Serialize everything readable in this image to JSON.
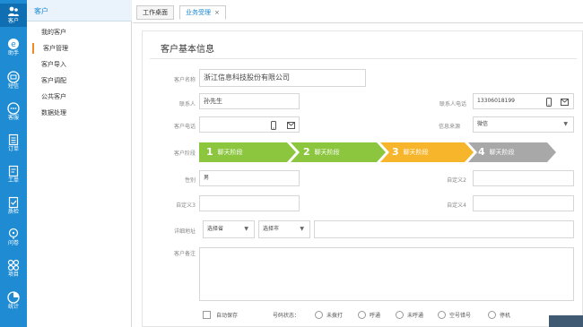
{
  "rail": [
    {
      "label": "客户",
      "icon": "customer-icon"
    },
    {
      "label": "助手",
      "icon": "assistant-icon"
    },
    {
      "label": "短信",
      "icon": "sms-icon"
    },
    {
      "label": "客服",
      "icon": "chat-icon"
    },
    {
      "label": "订单",
      "icon": "order-icon"
    },
    {
      "label": "工单",
      "icon": "ticket-icon"
    },
    {
      "label": "质检",
      "icon": "quality-check-icon"
    },
    {
      "label": "问卷",
      "icon": "survey-icon"
    },
    {
      "label": "项目",
      "icon": "project-icon"
    },
    {
      "label": "统计",
      "icon": "statistics-icon"
    }
  ],
  "subnav": {
    "title": "客户",
    "items": [
      "我的客户",
      "客户管理",
      "客户导入",
      "客户调配",
      "公共客户",
      "数据处理"
    ]
  },
  "tabs": [
    {
      "label": "工作桌面"
    },
    {
      "label": "业务受理",
      "close": "×"
    }
  ],
  "form": {
    "title": "客户基本信息",
    "name_label": "客户名称",
    "name_value": "浙江信息科技股份有限公司",
    "contact_label": "联系人",
    "contact_value": "孙先生",
    "contact_phone_label": "联系人电话",
    "contact_phone_value": "13306018199",
    "phone_label": "客户电话",
    "source_label": "信息来源",
    "source_value": "微信",
    "stage_label": "客户阶段",
    "stages": [
      {
        "num": "1",
        "label": "聊天阶段"
      },
      {
        "num": "2",
        "label": "聊天阶段"
      },
      {
        "num": "3",
        "label": "聊天阶段"
      },
      {
        "num": "4",
        "label": "聊天阶段"
      }
    ],
    "gender_label": "性别",
    "gender_value": "男",
    "custom2_label": "自定义2",
    "custom3_label": "自定义3",
    "custom4_label": "自定义4",
    "address_label": "详细地址",
    "province_value": "选择省",
    "city_value": "选择市",
    "remark_label": "客户备注"
  },
  "bottom": {
    "autosave_label": "自动保存",
    "status_label": "号码状态：",
    "options": [
      "未拨打",
      "呼通",
      "未呼通",
      "空号错号",
      "停机"
    ]
  },
  "colors": {
    "rail": "#1e8bd3",
    "stage_active": "#8cc63f",
    "stage_current": "#f7b52c",
    "stage_future": "#a8a8a8"
  }
}
